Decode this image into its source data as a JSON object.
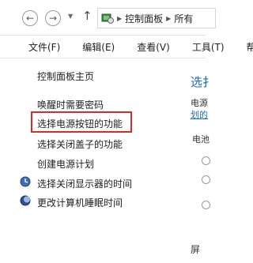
{
  "address": {
    "crumbs": [
      "控制面板",
      "所有"
    ]
  },
  "menu": {
    "file": "文件(F)",
    "edit": "编辑(E)",
    "view": "查看(V)",
    "tools": "工具(T)",
    "help": "帮"
  },
  "sidebar": {
    "items": [
      {
        "label": "控制面板主页"
      },
      {
        "label": "唤醒时需要密码"
      },
      {
        "label": "选择电源按钮的功能"
      },
      {
        "label": "选择关闭盖子的功能"
      },
      {
        "label": "创建电源计划"
      },
      {
        "label": "选择关闭显示器的时间",
        "icon": "monitor-clock-icon"
      },
      {
        "label": "更改计算机睡眠时间",
        "icon": "moon-icon"
      }
    ]
  },
  "content": {
    "heading": "选扌",
    "line1": "电源",
    "line2": "划的",
    "line3": "电池",
    "line4": "屏"
  },
  "highlight_color": "#d92b2b"
}
